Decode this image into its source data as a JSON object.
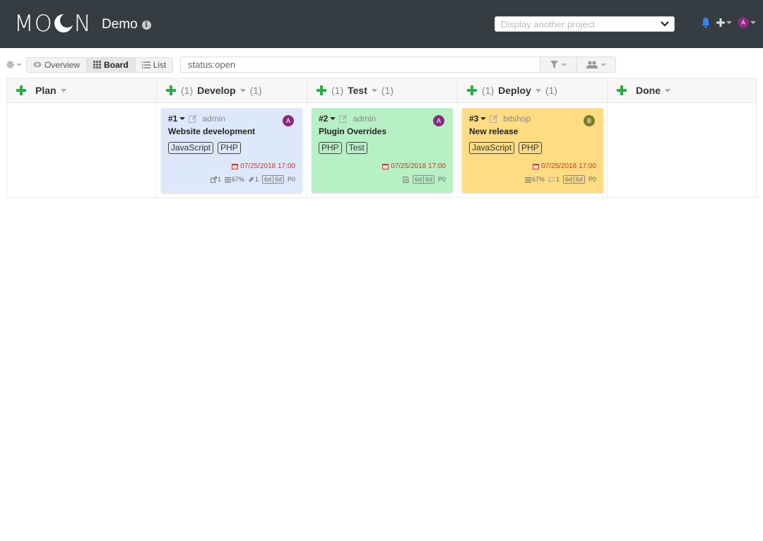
{
  "header": {
    "logo": {
      "left": "M",
      "o": "O",
      "right": "N"
    },
    "project": "Demo",
    "project_select_placeholder": "Display another project",
    "avatar": "A"
  },
  "colors": {
    "header_bg": "#353c42",
    "add_green": "#2fa84f",
    "card_blue": "#dde9fb",
    "card_green": "#b8f0c6",
    "card_yellow": "#fedc83",
    "due_red": "#c0392b",
    "avatar_purple": "#8a2a7e",
    "avatar_olive": "#7e7b26"
  },
  "toolbar": {
    "views": [
      {
        "label": "Overview",
        "icon": "eye-icon",
        "active": false
      },
      {
        "label": "Board",
        "icon": "grid-icon",
        "active": true
      },
      {
        "label": "List",
        "icon": "list-icon",
        "active": false
      }
    ],
    "search_value": "status:open"
  },
  "columns": [
    {
      "title": "Plan",
      "count_before": "",
      "count_after": ""
    },
    {
      "title": "Develop",
      "count_before": "(1)",
      "count_after": "(1)"
    },
    {
      "title": "Test",
      "count_before": "(1)",
      "count_after": "(1)"
    },
    {
      "title": "Deploy",
      "count_before": "(1)",
      "count_after": "(1)"
    },
    {
      "title": "Done",
      "count_before": "",
      "count_after": ""
    }
  ],
  "cards": [
    {
      "number": "#1",
      "owner": "admin",
      "avatar": "A",
      "title": "Website development",
      "tags": [
        "JavaScript",
        "PHP"
      ],
      "due": "07/25/2018 17:00",
      "links": "1",
      "progress": "67%",
      "attachments": "1",
      "est_a": "6d",
      "est_b": "6d",
      "priority": "P0"
    },
    {
      "number": "#2",
      "owner": "admin",
      "avatar": "A",
      "title": "Plugin Overrides",
      "tags": [
        "PHP",
        "Test"
      ],
      "due": "07/25/2018 17:00",
      "est_a": "6d",
      "est_b": "6d",
      "priority": "P0"
    },
    {
      "number": "#3",
      "owner": "bitshop",
      "avatar": "B",
      "title": "New release",
      "tags": [
        "JavaScript",
        "PHP"
      ],
      "due": "07/25/2018 17:00",
      "progress": "67%",
      "comments": "1",
      "est_a": "6d",
      "est_b": "6d",
      "priority": "P0"
    }
  ]
}
